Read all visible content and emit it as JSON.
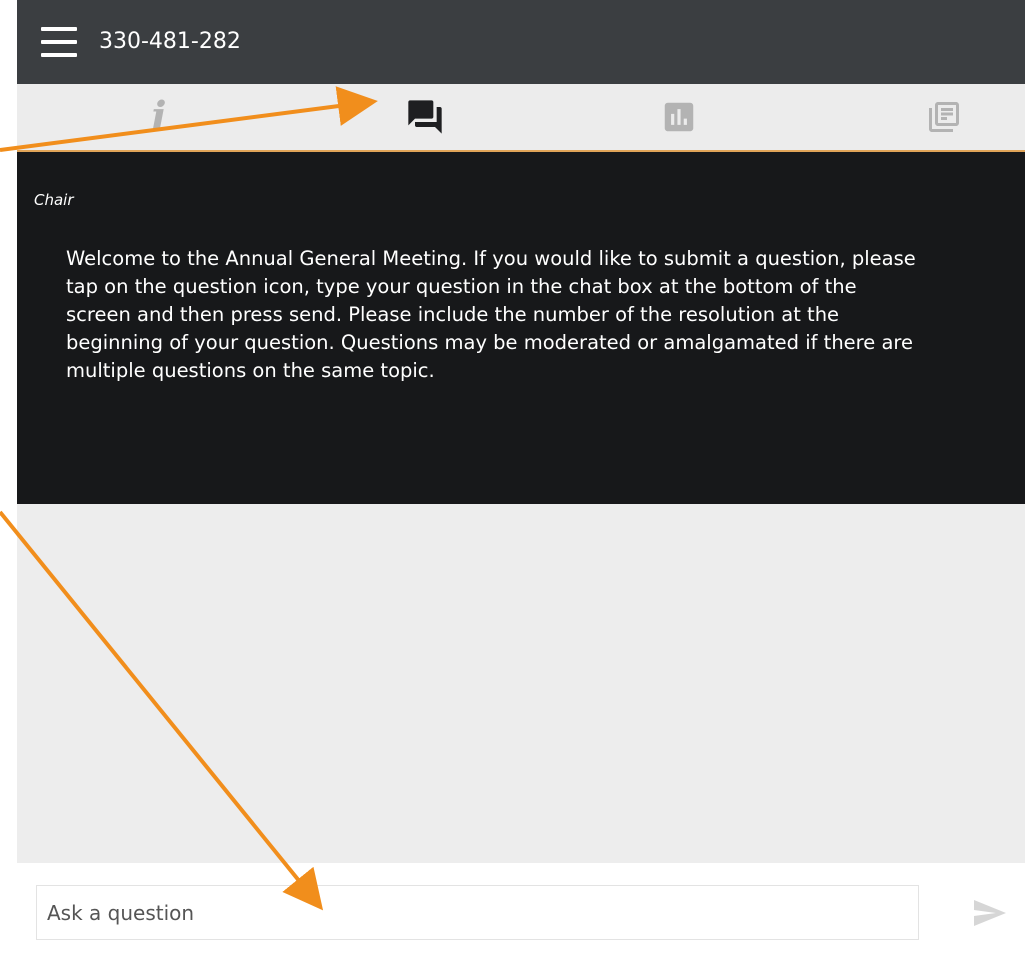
{
  "header": {
    "meeting_id": "330-481-282",
    "menu_icon": "hamburger-icon"
  },
  "tabs": [
    {
      "name": "info",
      "icon": "info-icon",
      "glyph": "i",
      "active": false
    },
    {
      "name": "questions",
      "icon": "chat-icon",
      "active": true
    },
    {
      "name": "polls",
      "icon": "bar-chart-icon",
      "active": false
    },
    {
      "name": "documents",
      "icon": "documents-icon",
      "active": false
    }
  ],
  "messages": [
    {
      "sender": "Chair",
      "text": "Welcome to the Annual General Meeting. If you would like to submit a question, please tap on the question icon, type your question in the chat box at the bottom of the screen and then press send. Please include the number of the resolution at the beginning of your question. Questions may be moderated or amalgamated if there are multiple questions on the same topic."
    }
  ],
  "composer": {
    "placeholder": "Ask a question",
    "value": "",
    "send_icon": "send-icon"
  },
  "colors": {
    "header_bg": "#3b3e41",
    "tabbar_bg": "#ececec",
    "active_tab_icon": "#1e1f21",
    "inactive_tab_icon": "#b3b3b3",
    "tab_underline": "#e0a458",
    "message_bg": "#17181a",
    "content_bg": "#ededed",
    "annotation_arrow": "#f18e1c",
    "send_icon": "#d6d6d6"
  }
}
